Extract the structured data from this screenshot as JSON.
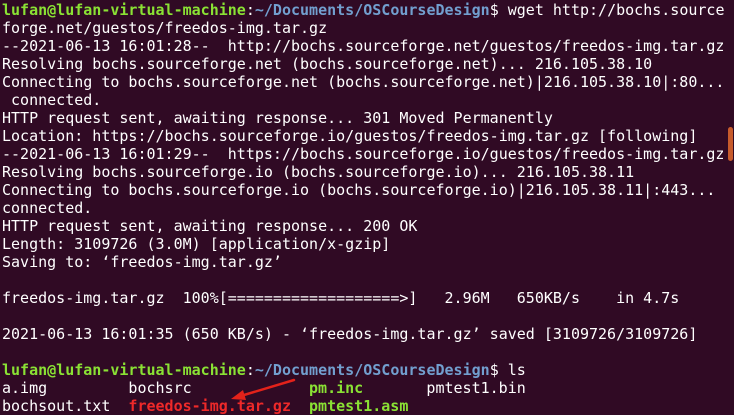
{
  "colors": {
    "background": "#300A24",
    "text": "#FFFFFF",
    "prompt_user_host": "#8AE234",
    "prompt_cwd": "#729FCF",
    "executable_file": "#8AE234",
    "archive_file": "#EF2929",
    "annotation_arrow": "#E3221A",
    "scrollbar_thumb": "#C75B2C"
  },
  "terminal": {
    "prompt": {
      "user_host": "lufan@lufan-virtual-machine",
      "separator": ":",
      "cwd": "~/Documents/OSCourseDesign",
      "symbol": "$"
    },
    "wget": {
      "command": [
        "wget http://bochs.source",
        "forge.net/guestos/freedos-img.tar.gz"
      ],
      "log": [
        "--2021-06-13 16:01:28--  http://bochs.sourceforge.net/guestos/freedos-img.tar.gz",
        "Resolving bochs.sourceforge.net (bochs.sourceforge.net)... 216.105.38.10",
        "Connecting to bochs.sourceforge.net (bochs.sourceforge.net)|216.105.38.10|:80...",
        " connected.",
        "HTTP request sent, awaiting response... 301 Moved Permanently",
        "Location: https://bochs.sourceforge.io/guestos/freedos-img.tar.gz [following]",
        "--2021-06-13 16:01:29--  https://bochs.sourceforge.io/guestos/freedos-img.tar.gz",
        "Resolving bochs.sourceforge.io (bochs.sourceforge.io)... 216.105.38.11",
        "Connecting to bochs.sourceforge.io (bochs.sourceforge.io)|216.105.38.11|:443...",
        "connected.",
        "HTTP request sent, awaiting response... 200 OK",
        "Length: 3109726 (3.0M) [application/x-gzip]",
        "Saving to: ‘freedos-img.tar.gz’"
      ],
      "progress": "freedos-img.tar.gz  100%[===================>]   2.96M   650KB/s    in 4.7s",
      "summary": "2021-06-13 16:01:35 (650 KB/s) - ‘freedos-img.tar.gz’ saved [3109726/3109726]"
    },
    "ls": {
      "command": "ls",
      "rows": [
        [
          "a.img",
          "bochsrc",
          "pm.inc",
          "pmtest1.bin"
        ],
        [
          "bochsout.txt",
          "freedos-img.tar.gz",
          "pmtest1.asm"
        ]
      ]
    }
  }
}
